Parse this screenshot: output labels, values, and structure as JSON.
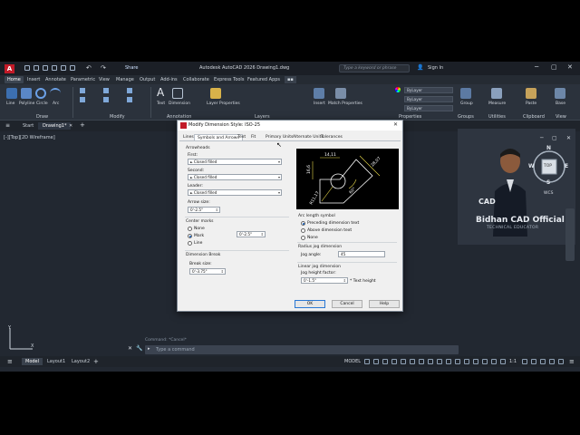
{
  "app": {
    "window_title": "Autodesk AutoCAD 2026   Drawing1.dwg",
    "share_label": "Share",
    "search_placeholder": "Type a keyword or phrase",
    "signin_label": "Sign In"
  },
  "ribbon_tabs": [
    "Home",
    "Insert",
    "Annotate",
    "Parametric",
    "View",
    "Manage",
    "Output",
    "Add-ins",
    "Collaborate",
    "Express Tools",
    "Featured Apps"
  ],
  "ribbon_panels": [
    "Draw",
    "Modify",
    "Annotation",
    "Layers",
    "Groups",
    "Utilities",
    "Clipboard",
    "View"
  ],
  "ribbon_tools": {
    "line": "Line",
    "polyline": "Polyline",
    "circle": "Circle",
    "arc": "Arc",
    "text": "Text",
    "dimension": "Dimension",
    "layer_properties": "Layer Properties",
    "insert": "Insert",
    "match_properties": "Match Properties",
    "group": "Group",
    "measure": "Measure",
    "paste": "Paste",
    "base": "Base",
    "by_layer": "ByLayer",
    "layer_name": "0"
  },
  "doc_tabs": [
    "Start",
    "Drawing1*"
  ],
  "viewport_label": "[-][Top][2D Wireframe]",
  "webcam": {
    "brand_name": "Bidhan CAD Official",
    "brand_subtitle": "TECHNICAL EDUCATOR",
    "viewcube": {
      "n": "N",
      "s": "S",
      "e": "E",
      "w": "W",
      "top": "TOP"
    },
    "wcs": "WCS"
  },
  "command": {
    "history": "Command: *Cancel*",
    "placeholder": "Type a command"
  },
  "status": {
    "tabs": [
      "Model",
      "Layout1",
      "Layout2"
    ],
    "model_label": "MODEL",
    "scale": "1:1"
  },
  "dialog": {
    "title": "Modify Dimension Style: ISO-25",
    "tabs": [
      "Lines",
      "Symbols and Arrows",
      "Text",
      "Fit",
      "Primary Units",
      "Alternate Units",
      "Tolerances"
    ],
    "active_tab": "Symbols and Arrows",
    "arrowheads": {
      "group": "Arrowheads",
      "first_label": "First:",
      "first_value": "Closed filled",
      "second_label": "Second:",
      "second_value": "Closed filled",
      "leader_label": "Leader:",
      "leader_value": "Closed filled",
      "arrow_size_label": "Arrow size:",
      "arrow_size_value": "0'-2.5\""
    },
    "center_marks": {
      "group": "Center marks",
      "none": "None",
      "mark": "Mark",
      "line": "Line",
      "size_value": "0'-2.5\""
    },
    "dimension_break": {
      "group": "Dimension Break",
      "break_size_label": "Break size:",
      "break_size_value": "0'-3.75\""
    },
    "arc_length_symbol": {
      "group": "Arc length symbol",
      "preceding": "Preceding dimension text",
      "above": "Above dimension text",
      "none": "None"
    },
    "radius_jog": {
      "group": "Radius jog dimension",
      "jog_angle_label": "Jog angle:",
      "jog_angle_value": "45"
    },
    "linear_jog": {
      "group": "Linear jog dimension",
      "factor_label": "Jog height factor:",
      "factor_value": "0'-1.5\"",
      "factor_suffix": "* Text height"
    },
    "preview": {
      "dim_top": "14,11",
      "dim_left": "16,6",
      "dim_right": "28,07",
      "dim_bottom": "R11,17",
      "dim_angle": "60°"
    },
    "buttons": {
      "ok": "OK",
      "cancel": "Cancel",
      "help": "Help"
    }
  }
}
